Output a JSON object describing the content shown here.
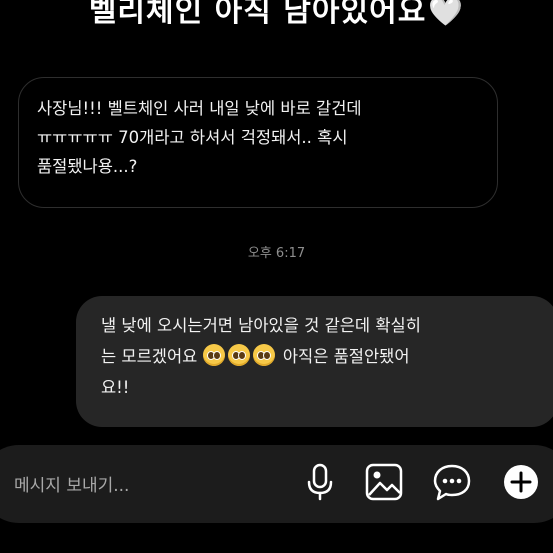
{
  "title": {
    "text": "벨리체인 아직 남아있어요",
    "heart": "🤍"
  },
  "messages": [
    {
      "direction": "incoming",
      "lines": [
        "사장님!!! 벨트체인 사러 내일 낮에 바로 갈건데",
        "ㅠㅠㅠㅠㅠ 70개라고 하셔서 걱정돼서.. 혹시",
        "품절됐나용...?"
      ]
    },
    {
      "direction": "outgoing",
      "lines": [
        "낼 낮에 오시는거면 남아있을 것 같은데 확실히",
        "는 모르겠어요",
        "아직은 품절안됐어",
        "요!!"
      ],
      "emoji_count": 3
    }
  ],
  "timestamp": "오후 6:17",
  "composer": {
    "placeholder": "메시지 보내기...",
    "icons": [
      "microphone-icon",
      "image-icon",
      "sticker-icon",
      "plus-icon"
    ]
  },
  "colors": {
    "background": "#000000",
    "outgoing_bubble": "#262626",
    "incoming_border": "#2e2e2e",
    "composer": "#1c1c1c"
  }
}
